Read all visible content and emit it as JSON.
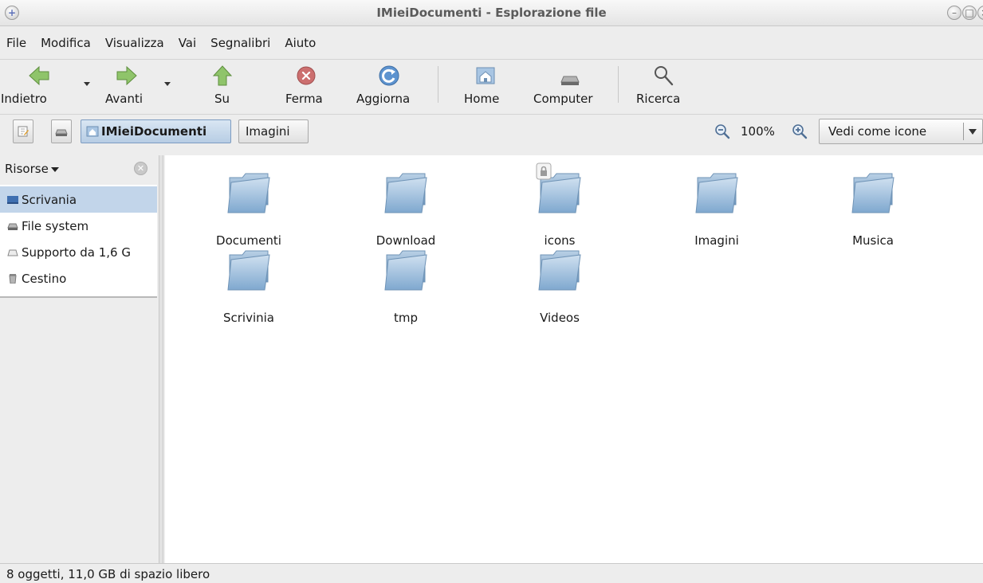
{
  "window": {
    "title": "IMieiDocumenti - Esplorazione file"
  },
  "menu": [
    {
      "label": "File"
    },
    {
      "label": "Modifica"
    },
    {
      "label": "Visualizza"
    },
    {
      "label": "Vai"
    },
    {
      "label": "Segnalibri"
    },
    {
      "label": "Aiuto"
    }
  ],
  "toolbar": {
    "back": "Indietro",
    "forward": "Avanti",
    "up": "Su",
    "stop": "Ferma",
    "reload": "Aggiorna",
    "home": "Home",
    "computer": "Computer",
    "search": "Ricerca"
  },
  "location": {
    "crumbs": [
      "IMieiDocumenti",
      "Imagini"
    ],
    "zoom": "100%",
    "view_mode": "Vedi come icone"
  },
  "sidebar": {
    "header": "Risorse",
    "items": [
      {
        "label": "Scrivania",
        "icon": "desktop-icon",
        "selected": true
      },
      {
        "label": "File system",
        "icon": "drive-icon"
      },
      {
        "label": "Supporto da 1,6 G",
        "icon": "removable-media-icon"
      },
      {
        "label": "Cestino",
        "icon": "trash-icon"
      }
    ]
  },
  "files": [
    {
      "name": "Documenti",
      "icon": "folder-icon"
    },
    {
      "name": "Download",
      "icon": "folder-icon"
    },
    {
      "name": "icons",
      "icon": "folder-icon",
      "locked": true
    },
    {
      "name": "Imagini",
      "icon": "folder-icon"
    },
    {
      "name": "Musica",
      "icon": "folder-icon"
    },
    {
      "name": "Scrivinia",
      "icon": "folder-icon"
    },
    {
      "name": "tmp",
      "icon": "folder-icon"
    },
    {
      "name": "Videos",
      "icon": "folder-icon"
    }
  ],
  "status": {
    "text": "8 oggetti, 11,0 GB di spazio libero"
  },
  "colors": {
    "selection": "#c2d5ea",
    "folder": "#8fb6d8",
    "accent": "#5b8fc7"
  }
}
